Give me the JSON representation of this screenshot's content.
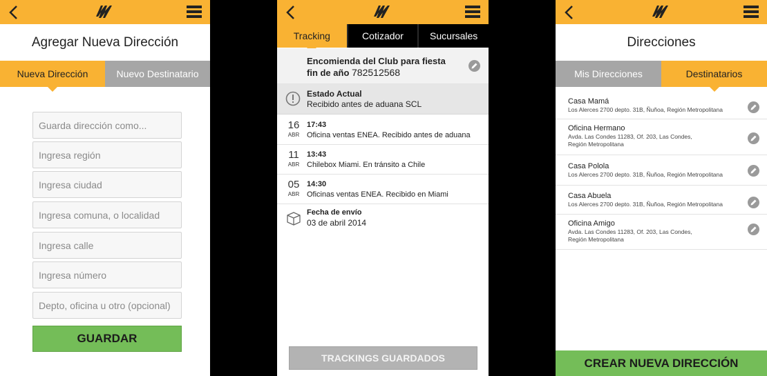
{
  "screen1": {
    "title": "Agregar Nueva Dirección",
    "tabs": [
      "Nueva Dirección",
      "Nuevo Destinatario"
    ],
    "fields": [
      "Guarda dirección como...",
      "Ingresa región",
      "Ingresa ciudad",
      "Ingresa comuna, o localidad",
      "Ingresa calle",
      "Ingresa número",
      "Depto, oficina u otro (opcional)"
    ],
    "save_label": "GUARDAR"
  },
  "screen2": {
    "tabs": [
      "Tracking",
      "Cotizador",
      "Sucursales"
    ],
    "package": {
      "name_line1": "Encomienda del Club para fiesta",
      "name_line2": "fin de año",
      "number": "782512568"
    },
    "status": {
      "title": "Estado Actual",
      "text": "Recibido antes de aduana SCL"
    },
    "events": [
      {
        "day": "16",
        "month": "ABR",
        "time": "17:43",
        "desc": "Oficina ventas ENEA. Recibido antes de aduana"
      },
      {
        "day": "11",
        "month": "ABR",
        "time": "13:43",
        "desc": "Chilebox Miami. En tránsito a Chile"
      },
      {
        "day": "05",
        "month": "ABR",
        "time": "14:30",
        "desc": "Oficinas ventas ENEA. Recibido en Miami"
      }
    ],
    "shipping": {
      "title": "Fecha de envío",
      "date": "03 de abril 2014"
    },
    "saved_button": "TRACKINGS GUARDADOS"
  },
  "screen3": {
    "title": "Direcciones",
    "tabs": [
      "Mis Direcciones",
      "Destinatarios"
    ],
    "addresses": [
      {
        "name": "Casa Mamá",
        "line1": "Los Alerces 2700 depto. 31B, Ñuñoa, Región Metropolitana",
        "line2": ""
      },
      {
        "name": "Oficina Hermano",
        "line1": "Avda. Las Condes 11283, Of. 203, Las Condes,",
        "line2": "Región Metropolitana"
      },
      {
        "name": "Casa Polola",
        "line1": "Los Alerces 2700 depto. 31B, Ñuñoa, Región Metropolitana",
        "line2": ""
      },
      {
        "name": "Casa Abuela",
        "line1": "Los Alerces 2700 depto. 31B, Ñuñoa, Región Metropolitana",
        "line2": ""
      },
      {
        "name": "Oficina Amigo",
        "line1": "Avda. Las Condes 11283, Of. 203, Las Condes,",
        "line2": "Región Metropolitana"
      }
    ],
    "create_label": "CREAR NUEVA DIRECCIÓN"
  },
  "icons": {
    "back": "back-arrow-icon",
    "logo": "logo-icon",
    "menu": "hamburger-menu-icon",
    "edit": "pencil-edit-icon",
    "alert": "exclamation-circle-icon",
    "box": "package-box-icon"
  },
  "colors": {
    "accent": "#f9b233",
    "inactive_tab": "#a6a6a6",
    "success": "#74bd58",
    "disabled": "#b3b3b3"
  }
}
